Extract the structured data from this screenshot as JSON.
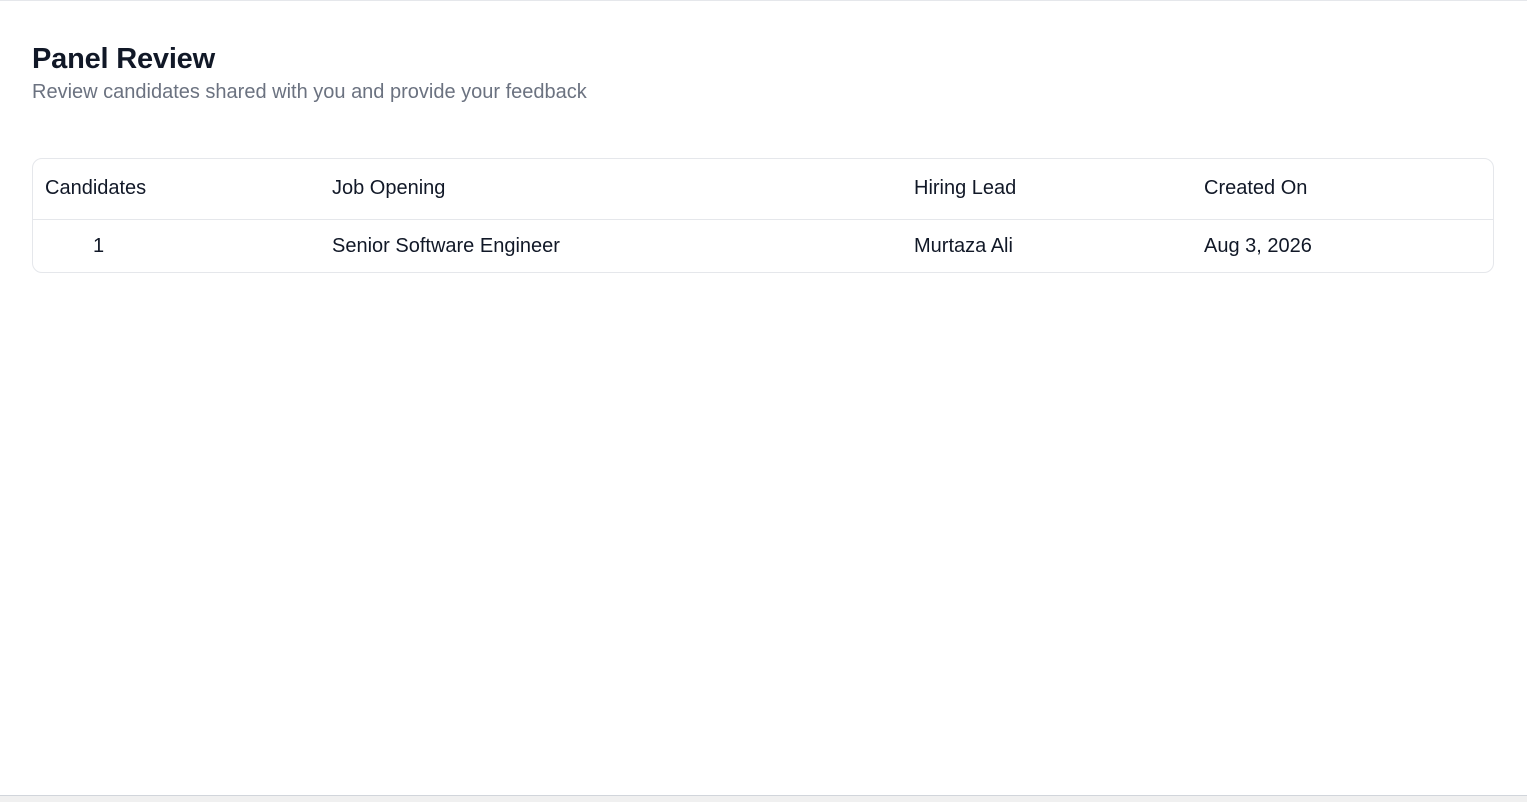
{
  "page": {
    "title": "Panel Review",
    "subtitle": "Review candidates shared with you and provide your feedback"
  },
  "table": {
    "columns": [
      "Candidates",
      "Job Opening",
      "Hiring Lead",
      "Created On"
    ],
    "rows": [
      {
        "candidates": "1",
        "job_opening": "Senior Software Engineer",
        "hiring_lead": "Murtaza Ali",
        "created_on": "Aug 3, 2026"
      }
    ]
  },
  "colors": {
    "text_primary": "#111827",
    "text_secondary": "#6b7280",
    "border": "#e5e7eb"
  }
}
